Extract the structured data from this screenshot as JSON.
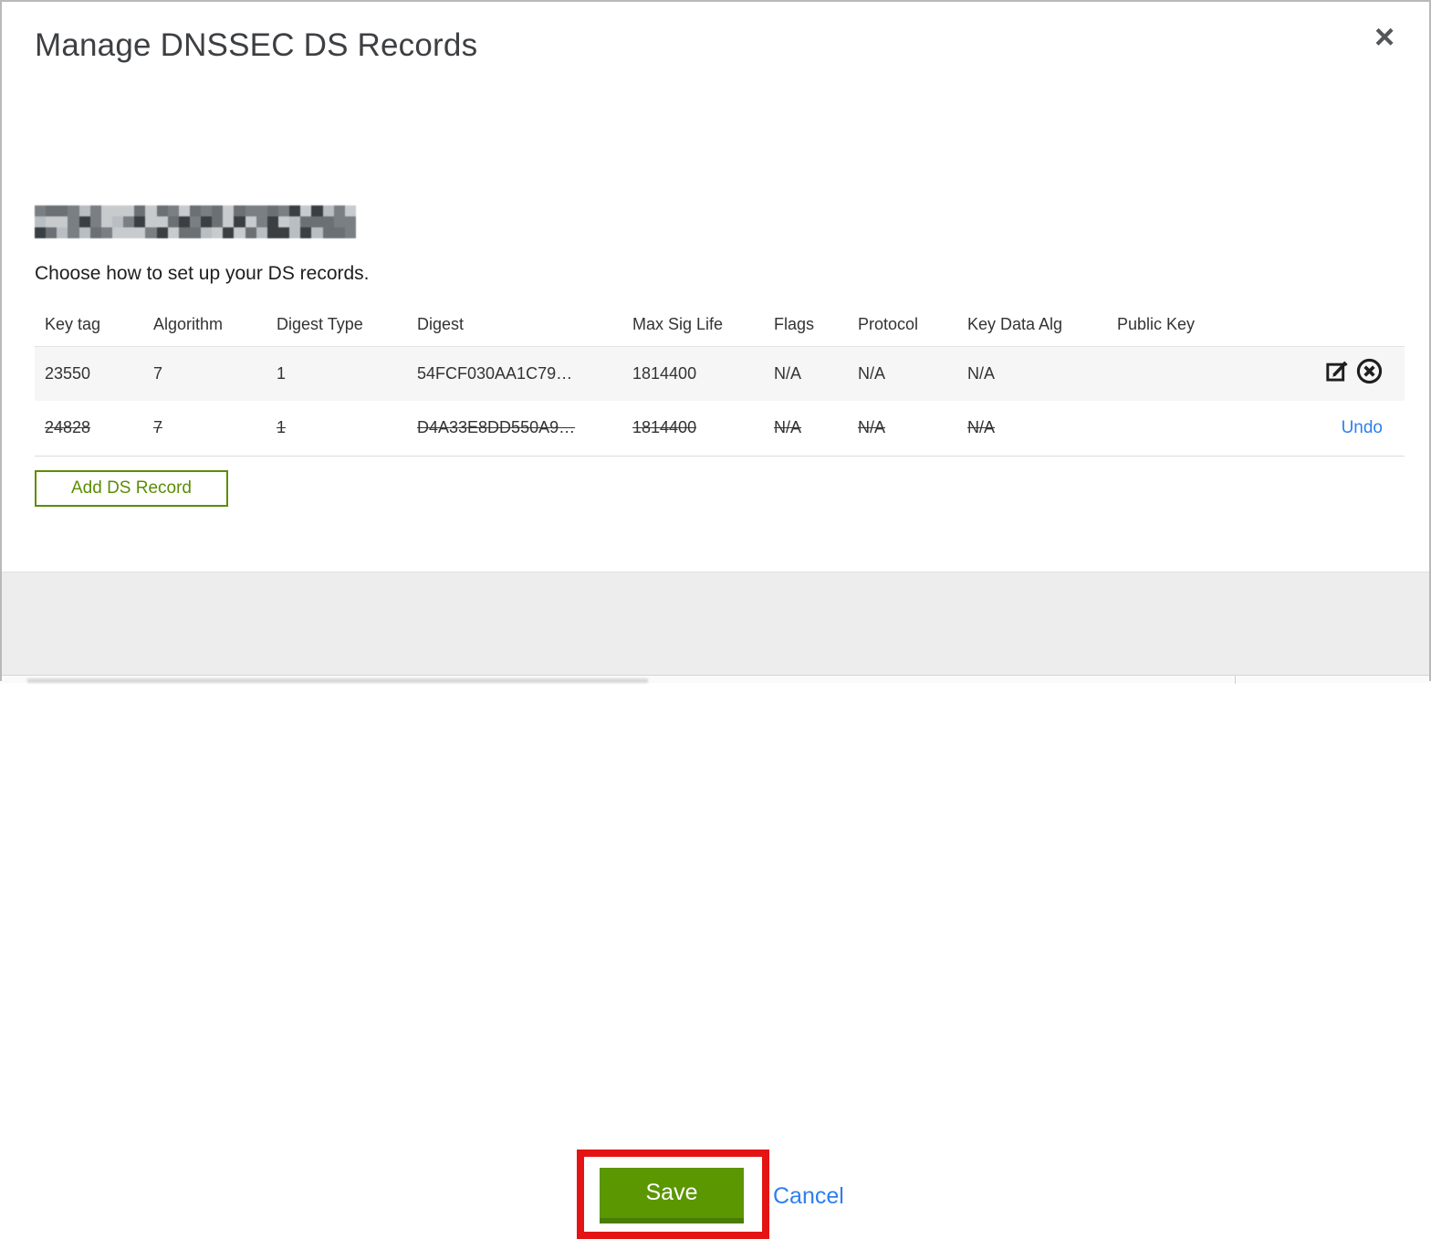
{
  "modal": {
    "title": "Manage DNSSEC DS Records",
    "close_label": "×",
    "instruction": "Choose how to set up your DS records.",
    "add_button_label": "Add DS Record",
    "save_label": "Save",
    "cancel_label": "Cancel",
    "undo_label": "Undo"
  },
  "table": {
    "headers": [
      "Key tag",
      "Algorithm",
      "Digest Type",
      "Digest",
      "Max Sig Life",
      "Flags",
      "Protocol",
      "Key Data Alg",
      "Public Key"
    ],
    "rows": [
      {
        "key_tag": "23550",
        "algorithm": "7",
        "digest_type": "1",
        "digest": "54FCF030AA1C79…",
        "max_sig_life": "1814400",
        "flags": "N/A",
        "protocol": "N/A",
        "key_data_alg": "N/A",
        "public_key": "",
        "state": "active"
      },
      {
        "key_tag": "24828",
        "algorithm": "7",
        "digest_type": "1",
        "digest": "D4A33E8DD550A9…",
        "max_sig_life": "1814400",
        "flags": "N/A",
        "protocol": "N/A",
        "key_data_alg": "N/A",
        "public_key": "",
        "state": "marked-for-deletion"
      }
    ]
  },
  "colors": {
    "accent_green": "#5b8d04",
    "save_green": "#5a9700",
    "save_green_shadow": "#4a7d06",
    "link_blue": "#2d7ff0",
    "annotation_red": "#e41414",
    "row_stripe": "#f6f6f6",
    "footer_gray": "#ededed"
  },
  "icons": {
    "edit": "edit-record-icon",
    "delete": "delete-record-icon",
    "close": "close-icon"
  },
  "redaction": {
    "rows": 3,
    "cols": 29,
    "palette": [
      "#3a3f44",
      "#565b60",
      "#7a7f84",
      "#9aa0a5",
      "#b9bec2",
      "#2e3236",
      "#6b7074",
      "#8e9397",
      "#c7cbce",
      "#44494e"
    ]
  }
}
